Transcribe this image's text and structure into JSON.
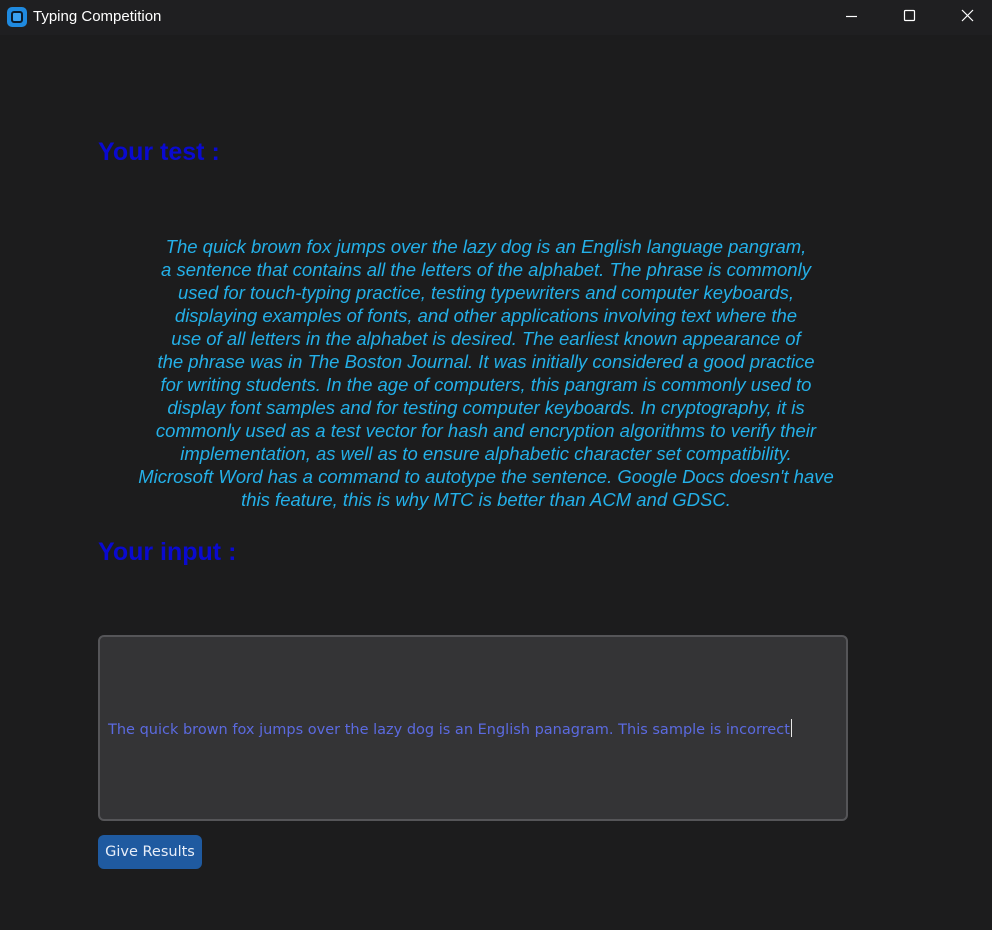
{
  "window": {
    "title": "Typing Competition",
    "controls": {
      "minimize": "minimize-icon",
      "maximize": "maximize-icon",
      "close": "close-icon"
    }
  },
  "main": {
    "test_heading": "Your test :",
    "test_lines": [
      "The quick brown fox jumps over the lazy dog is an English language pangram,",
      "a sentence that contains all the letters of the alphabet. The phrase is commonly",
      "used for touch-typing practice, testing typewriters and computer keyboards,",
      "displaying examples of fonts, and other applications involving text where the",
      "use of all letters in the alphabet is desired. The earliest known appearance of",
      "the phrase was in The Boston Journal. It was initially considered a good practice",
      "for writing students. In the age of computers, this pangram is commonly used to",
      "display font samples and for testing computer keyboards. In cryptography, it is",
      "commonly used as a test vector for hash and encryption algorithms to verify their",
      "implementation, as well as to ensure alphabetic character set compatibility.",
      "Microsoft Word has a command to autotype the sentence. Google Docs doesn't have",
      "this feature, this is why MTC is better than ACM and GDSC."
    ],
    "input_heading": "Your input :",
    "input_value": "The quick brown fox jumps over the lazy dog is an English panagram. This sample is incorrect",
    "results_button": "Give Results"
  },
  "colors": {
    "background": "#1c1c1d",
    "heading": "#0a0ad0",
    "sample_text": "#24b0e8",
    "input_text": "#5b6ae0",
    "button": "#1f5aa0"
  }
}
